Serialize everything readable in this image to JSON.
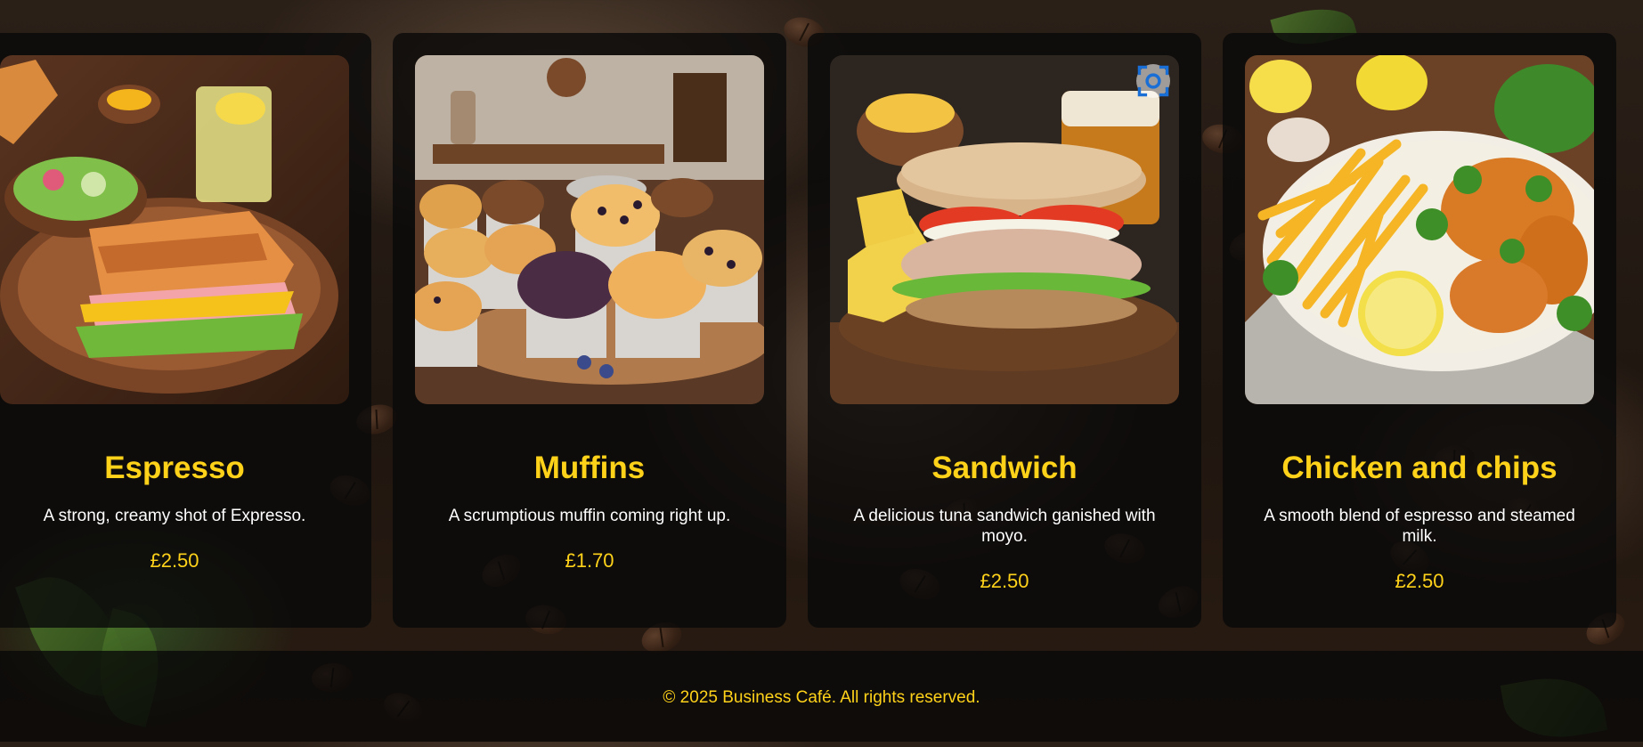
{
  "menu": {
    "items": [
      {
        "title": "Espresso",
        "description": "A strong, creamy shot of Expresso.",
        "price": "£2.50",
        "image_icon": "ham-cheese-toastie-photo"
      },
      {
        "title": "Muffins",
        "description": "A scrumptious muffin coming right up.",
        "price": "£1.70",
        "image_icon": "muffins-photo"
      },
      {
        "title": "Sandwich",
        "description": "A delicious tuna sandwich ganished with moyo.",
        "price": "£2.50",
        "image_icon": "tuna-sandwich-photo"
      },
      {
        "title": "Chicken and chips",
        "description": "A smooth blend of espresso and steamed milk.",
        "price": "£2.50",
        "image_icon": "chicken-and-chips-photo"
      }
    ]
  },
  "footer": {
    "copyright": "© 2025 Business Café. All rights reserved."
  },
  "colors": {
    "accent": "#ffd21a",
    "card_background": "#0a0a0a",
    "text": "#ffffff"
  }
}
